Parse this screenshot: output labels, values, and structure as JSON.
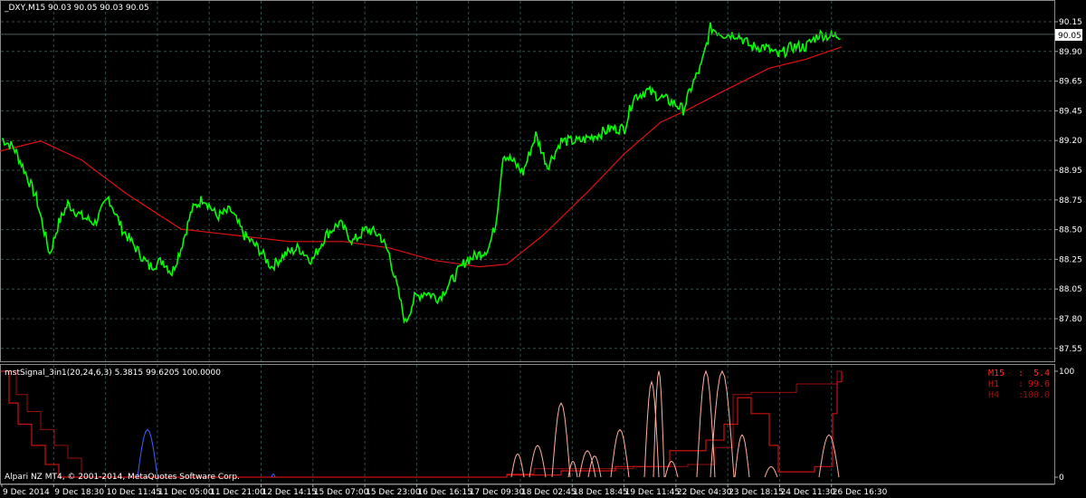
{
  "main_chart": {
    "header": "_DXY,M15  90.03 90.05 90.03 90.05",
    "current_price": "90.05",
    "y_ticks": [
      "90.15",
      "89.90",
      "89.65",
      "89.45",
      "89.20",
      "88.95",
      "88.75",
      "88.50",
      "88.25",
      "88.05",
      "87.80",
      "87.55"
    ],
    "x_ticks": [
      "9 Dec 2014",
      "9 Dec 18:30",
      "10 Dec 11:45",
      "11 Dec 05:00",
      "11 Dec 21:00",
      "12 Dec 14:15",
      "15 Dec 07:00",
      "15 Dec 23:00",
      "16 Dec 16:15",
      "17 Dec 09:30",
      "18 Dec 02:45",
      "18 Dec 18:45",
      "19 Dec 11:45",
      "22 Dec 04:30",
      "23 Dec 18:15",
      "24 Dec 11:30",
      "26 Dec 16:30"
    ]
  },
  "indicator": {
    "header": "mstSignal_3in1(20,24,6,3) 5.3815 99.6205 100.0000",
    "y_ticks": [
      "100",
      "0"
    ],
    "legend": [
      {
        "label": "M15",
        "value": "5.4",
        "color": "#ff2a2a"
      },
      {
        "label": "H1",
        "value": "99.6",
        "color": "#cc1111"
      },
      {
        "label": "H4",
        "value": "100.0",
        "color": "#991111"
      }
    ],
    "copyright": "Alpari NZ MT4, © 2001-2014, MetaQuotes Software Corp."
  },
  "colors": {
    "background": "#000000",
    "grid": "#2f4f4f",
    "price": "#00ff00",
    "moving_average": "#e01010",
    "text": "#ffffff"
  },
  "chart_data": [
    {
      "type": "line",
      "title": "_DXY,M15",
      "ylim": [
        87.5,
        90.2
      ],
      "x": [
        "9 Dec 2014",
        "9 Dec 18:30",
        "10 Dec 11:45",
        "11 Dec 05:00",
        "11 Dec 21:00",
        "12 Dec 14:15",
        "15 Dec 07:00",
        "15 Dec 23:00",
        "16 Dec 16:15",
        "17 Dec 09:30",
        "18 Dec 02:45",
        "18 Dec 18:45",
        "19 Dec 11:45",
        "22 Dec 04:30",
        "23 Dec 18:15",
        "24 Dec 11:30",
        "26 Dec 16:30"
      ],
      "series": [
        {
          "values": [
            89.25,
            88.4,
            88.7,
            88.35,
            88.75,
            88.6,
            88.5,
            88.55,
            88.4,
            87.9,
            88.3,
            89.0,
            89.3,
            89.6,
            89.45,
            90.1,
            89.95,
            90.05
          ]
        },
        {
          "values": [
            89.15,
            89.1,
            89.0,
            88.75,
            88.5,
            88.45,
            88.4,
            88.38,
            88.3,
            88.2,
            88.3,
            88.6,
            88.95,
            89.25,
            89.55,
            89.75,
            89.85,
            89.95
          ]
        }
      ]
    },
    {
      "type": "line",
      "title": "mstSignal_3in1(20,24,6,3)",
      "ylim": [
        0,
        100
      ],
      "series": [
        {
          "name": "M15",
          "values": [
            100,
            30,
            0,
            0,
            0,
            0,
            0,
            0,
            0,
            0,
            0,
            20,
            60,
            5,
            100,
            60,
            30,
            5
          ]
        },
        {
          "name": "H1",
          "values": [
            100,
            60,
            10,
            0,
            0,
            0,
            0,
            0,
            0,
            0,
            0,
            5,
            10,
            15,
            20,
            40,
            60,
            100
          ]
        },
        {
          "name": "H4",
          "values": [
            100,
            80,
            40,
            0,
            0,
            0,
            0,
            0,
            0,
            0,
            0,
            5,
            10,
            15,
            25,
            70,
            90,
            100
          ]
        }
      ]
    }
  ]
}
